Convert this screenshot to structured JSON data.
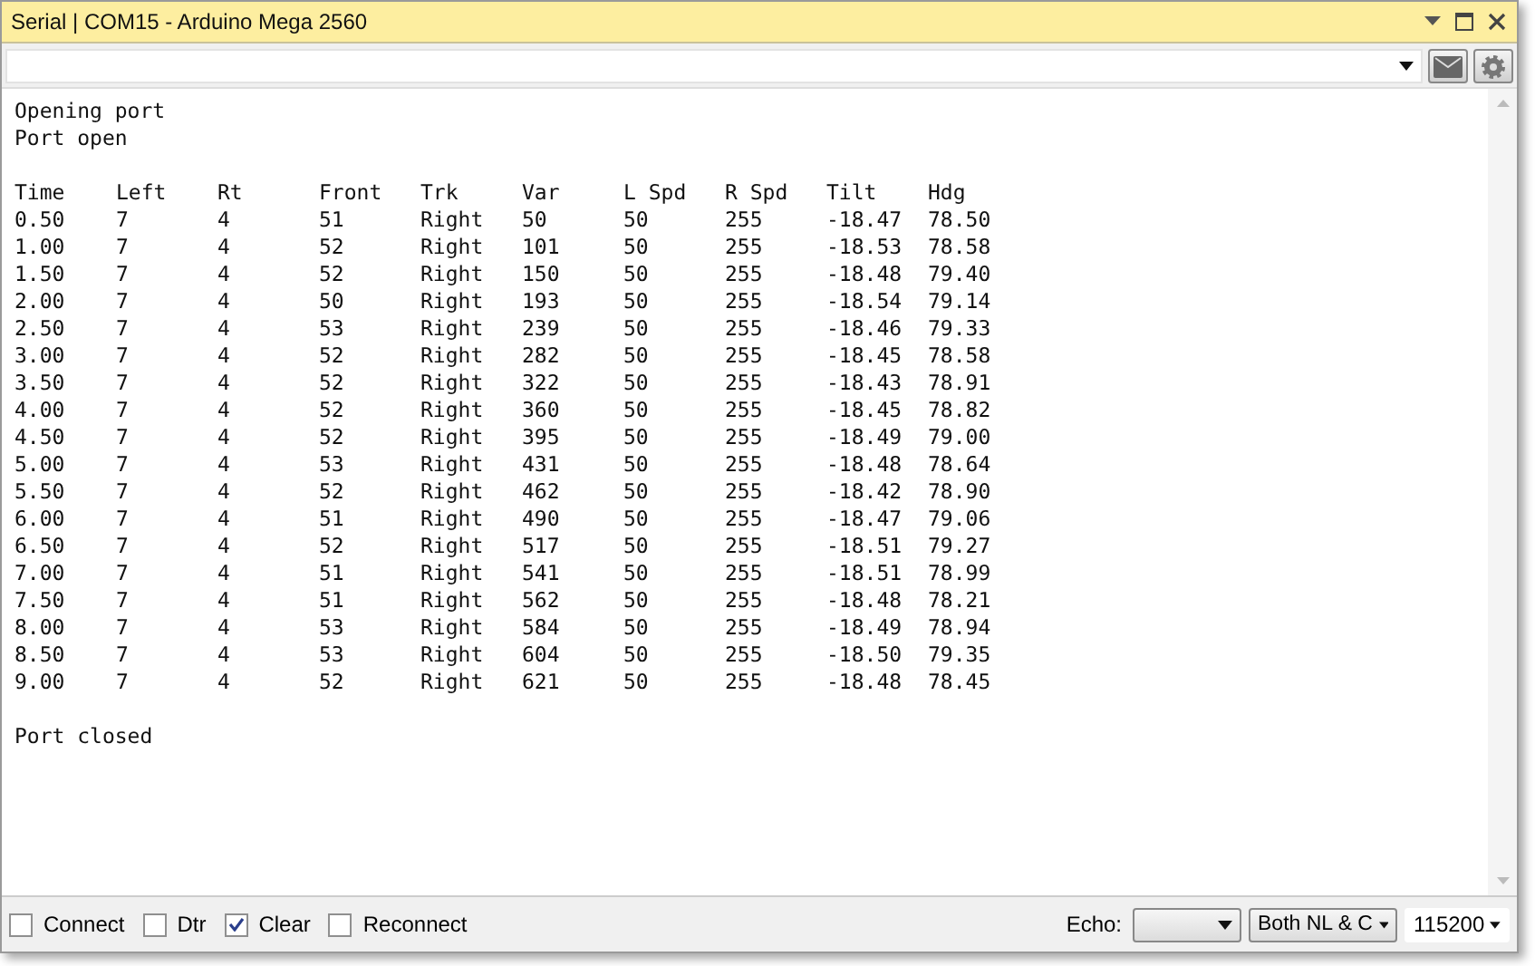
{
  "window": {
    "title": "Serial | COM15 - Arduino Mega 2560"
  },
  "output": {
    "intro": [
      "Opening port",
      "Port open"
    ],
    "columns": [
      "Time",
      "Left",
      "Rt",
      "Front",
      "Trk",
      "Var",
      "L Spd",
      "R Spd",
      "Tilt",
      "Hdg"
    ],
    "rows": [
      [
        "0.50",
        "7",
        "4",
        "51",
        "Right",
        "50",
        "50",
        "255",
        "-18.47",
        "78.50"
      ],
      [
        "1.00",
        "7",
        "4",
        "52",
        "Right",
        "101",
        "50",
        "255",
        "-18.53",
        "78.58"
      ],
      [
        "1.50",
        "7",
        "4",
        "52",
        "Right",
        "150",
        "50",
        "255",
        "-18.48",
        "79.40"
      ],
      [
        "2.00",
        "7",
        "4",
        "50",
        "Right",
        "193",
        "50",
        "255",
        "-18.54",
        "79.14"
      ],
      [
        "2.50",
        "7",
        "4",
        "53",
        "Right",
        "239",
        "50",
        "255",
        "-18.46",
        "79.33"
      ],
      [
        "3.00",
        "7",
        "4",
        "52",
        "Right",
        "282",
        "50",
        "255",
        "-18.45",
        "78.58"
      ],
      [
        "3.50",
        "7",
        "4",
        "52",
        "Right",
        "322",
        "50",
        "255",
        "-18.43",
        "78.91"
      ],
      [
        "4.00",
        "7",
        "4",
        "52",
        "Right",
        "360",
        "50",
        "255",
        "-18.45",
        "78.82"
      ],
      [
        "4.50",
        "7",
        "4",
        "52",
        "Right",
        "395",
        "50",
        "255",
        "-18.49",
        "79.00"
      ],
      [
        "5.00",
        "7",
        "4",
        "53",
        "Right",
        "431",
        "50",
        "255",
        "-18.48",
        "78.64"
      ],
      [
        "5.50",
        "7",
        "4",
        "52",
        "Right",
        "462",
        "50",
        "255",
        "-18.42",
        "78.90"
      ],
      [
        "6.00",
        "7",
        "4",
        "51",
        "Right",
        "490",
        "50",
        "255",
        "-18.47",
        "79.06"
      ],
      [
        "6.50",
        "7",
        "4",
        "52",
        "Right",
        "517",
        "50",
        "255",
        "-18.51",
        "79.27"
      ],
      [
        "7.00",
        "7",
        "4",
        "51",
        "Right",
        "541",
        "50",
        "255",
        "-18.51",
        "78.99"
      ],
      [
        "7.50",
        "7",
        "4",
        "51",
        "Right",
        "562",
        "50",
        "255",
        "-18.48",
        "78.21"
      ],
      [
        "8.00",
        "7",
        "4",
        "53",
        "Right",
        "584",
        "50",
        "255",
        "-18.49",
        "78.94"
      ],
      [
        "8.50",
        "7",
        "4",
        "53",
        "Right",
        "604",
        "50",
        "255",
        "-18.50",
        "79.35"
      ],
      [
        "9.00",
        "7",
        "4",
        "52",
        "Right",
        "621",
        "50",
        "255",
        "-18.48",
        "78.45"
      ]
    ],
    "outro": [
      "Port closed"
    ]
  },
  "options": [
    {
      "label": "Connect",
      "checked": false
    },
    {
      "label": "Dtr",
      "checked": false
    },
    {
      "label": "Clear",
      "checked": true
    },
    {
      "label": "Reconnect",
      "checked": false
    }
  ],
  "echo": {
    "label": "Echo:"
  },
  "line_ending": {
    "value": "Both NL & C"
  },
  "baud": {
    "value": "115200"
  }
}
